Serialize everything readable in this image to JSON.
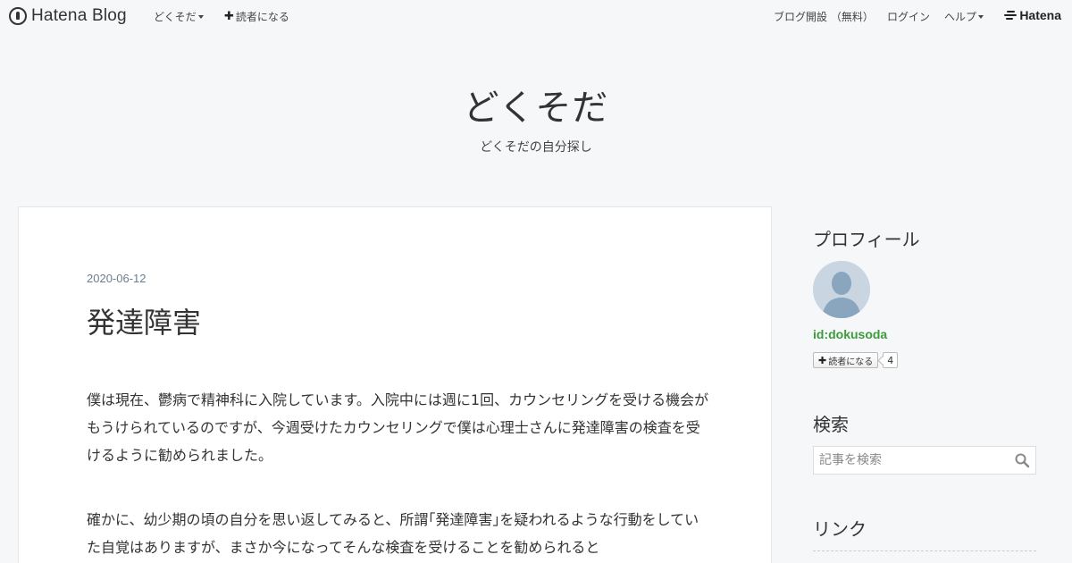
{
  "globalheader": {
    "brand": "Hatena Blog",
    "blog_menu": "どくそだ",
    "subscribe": "読者になる",
    "open_blog": "ブログ開設 （無料）",
    "login": "ログイン",
    "help": "ヘルプ",
    "hatena": "Hatena"
  },
  "blog": {
    "title": "どくそだ",
    "description": "どくそだの自分探し"
  },
  "entry": {
    "date": "2020-06-12",
    "title": "発達障害",
    "paragraphs": [
      "僕は現在、鬱病で精神科に入院しています。入院中には週に1回、カウンセリングを受ける機会がもうけられているのですが、今週受けたカウンセリングで僕は心理士さんに発達障害の検査を受けるように勧められました。",
      "確かに、幼少期の頃の自分を思い返してみると、所謂｢発達障害｣を疑われるような行動をしていた自覚はありますが、まさか今になってそんな検査を受けることを勧められると"
    ]
  },
  "sidebar": {
    "profile_heading": "プロフィール",
    "profile_id": "id:dokusoda",
    "subscribe_label": "読者になる",
    "subscriber_count": "4",
    "search_heading": "検索",
    "search_placeholder": "記事を検索",
    "links_heading": "リンク"
  }
}
